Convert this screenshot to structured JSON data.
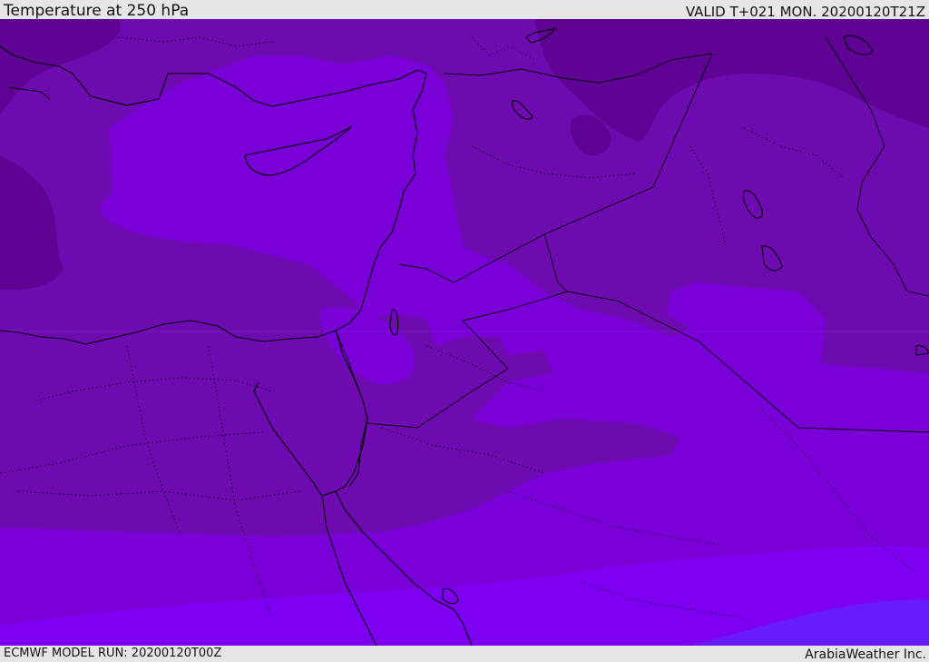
{
  "header": {
    "title": "Temperature at 250 hPa",
    "valid": "VALID T+021 MON. 20200120T21Z"
  },
  "footer": {
    "model_run": "ECMWF MODEL RUN: 20200120T00Z",
    "credit": "ArabiaWeather Inc."
  },
  "colors": {
    "band_coldest": "#5e0394",
    "band_cold": "#6e0bb0",
    "band_mid": "#7a00d8",
    "band_warm": "#7d00f2",
    "band_warmest": "#6a1aff",
    "coastline": "#000000",
    "frame": "#e6e6e6"
  },
  "map": {
    "field": "temperature",
    "level": "250 hPa",
    "region": "Eastern Mediterranean / Middle East"
  }
}
